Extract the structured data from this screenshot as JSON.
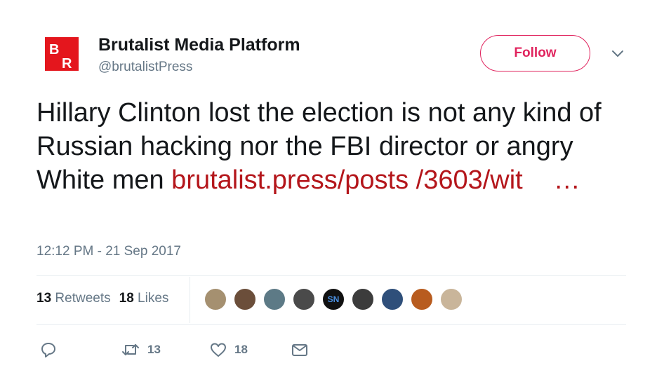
{
  "account": {
    "display_name": "Brutalist Media Platform",
    "handle": "@brutalistPress",
    "avatar_letters": [
      "B",
      "R"
    ],
    "avatar_color": "#e4161d"
  },
  "follow_button": {
    "label": "Follow",
    "color": "#e0245e"
  },
  "tweet": {
    "text": "Hillary Clinton lost the election is not any kind of Russian hacking  nor the FBI director or angry White men ",
    "link_text": "brutalist.press/posts /3603/wit",
    "ellipsis": "…",
    "link_color": "#b4161b"
  },
  "timestamp": "12:12 PM - 21 Sep 2017",
  "stats": {
    "retweets_count": "13",
    "retweets_label": "Retweets",
    "likes_count": "18",
    "likes_label": "Likes"
  },
  "likers": [
    {
      "icon": "avatar-photo-1",
      "color": "#a59070"
    },
    {
      "icon": "avatar-photo-2",
      "color": "#6b4e3a"
    },
    {
      "icon": "avatar-photo-3",
      "color": "#5d7a86"
    },
    {
      "icon": "avatar-photo-4",
      "color": "#4a4a4a"
    },
    {
      "icon": "avatar-photo-5",
      "color": "#111111",
      "text": "SN"
    },
    {
      "icon": "avatar-photo-6",
      "color": "#3c3c3c"
    },
    {
      "icon": "avatar-photo-7",
      "color": "#2f4f7a"
    },
    {
      "icon": "avatar-photo-8",
      "color": "#b85c1f"
    },
    {
      "icon": "avatar-photo-9",
      "color": "#c9b59a"
    }
  ],
  "actions": {
    "reply": {
      "icon": "reply-icon",
      "count": ""
    },
    "retweet": {
      "icon": "retweet-icon",
      "count": "13"
    },
    "like": {
      "icon": "heart-icon",
      "count": "18"
    },
    "message": {
      "icon": "envelope-icon",
      "count": ""
    }
  }
}
